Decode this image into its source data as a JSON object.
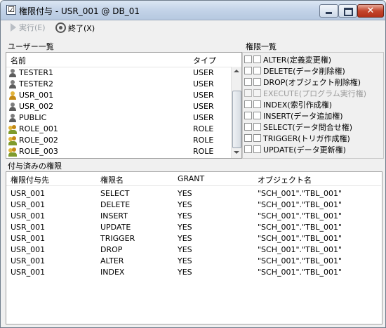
{
  "window": {
    "title": "権限付与 - USR_001 @ DB_01",
    "check": "☑",
    "close_glyph": "✕"
  },
  "toolbar": {
    "run_label": "実行(E)",
    "end_label": "終了(X)"
  },
  "users": {
    "section_label": "ユーザー一覧",
    "headers": {
      "name": "名前",
      "type": "タイプ"
    },
    "rows": [
      {
        "name": "TESTER1",
        "type": "USER",
        "icon": "user-icon"
      },
      {
        "name": "TESTER2",
        "type": "USER",
        "icon": "user-icon"
      },
      {
        "name": "USR_001",
        "type": "USER",
        "icon": "user-selected-icon"
      },
      {
        "name": "USR_002",
        "type": "USER",
        "icon": "user-icon"
      },
      {
        "name": "PUBLIC",
        "type": "USER",
        "icon": "user-icon"
      },
      {
        "name": "ROLE_001",
        "type": "ROLE",
        "icon": "role-icon"
      },
      {
        "name": "ROLE_002",
        "type": "ROLE",
        "icon": "role-icon"
      },
      {
        "name": "ROLE_003",
        "type": "ROLE",
        "icon": "role-icon"
      }
    ]
  },
  "permissions": {
    "section_label": "権限一覧",
    "items": [
      {
        "label": "ALTER(定義変更権)",
        "enabled": true
      },
      {
        "label": "DELETE(データ削除権)",
        "enabled": true
      },
      {
        "label": "DROP(オブジェクト削除権)",
        "enabled": true
      },
      {
        "label": "EXECUTE(プログラム実行権)",
        "enabled": false
      },
      {
        "label": "INDEX(索引作成権)",
        "enabled": true
      },
      {
        "label": "INSERT(データ追加権)",
        "enabled": true
      },
      {
        "label": "SELECT(データ問合せ権)",
        "enabled": true
      },
      {
        "label": "TRIGGER(トリガ作成権)",
        "enabled": true
      },
      {
        "label": "UPDATE(データ更新権)",
        "enabled": true
      }
    ]
  },
  "granted": {
    "section_label": "付与済みの権限",
    "headers": {
      "grantee": "権限付与先",
      "privilege": "権限名",
      "grant": "GRANT",
      "object": "オブジェクト名"
    },
    "rows": [
      {
        "grantee": "USR_001",
        "privilege": "SELECT",
        "grant": "YES",
        "object": "\"SCH_001\".\"TBL_001\""
      },
      {
        "grantee": "USR_001",
        "privilege": "DELETE",
        "grant": "YES",
        "object": "\"SCH_001\".\"TBL_001\""
      },
      {
        "grantee": "USR_001",
        "privilege": "INSERT",
        "grant": "YES",
        "object": "\"SCH_001\".\"TBL_001\""
      },
      {
        "grantee": "USR_001",
        "privilege": "UPDATE",
        "grant": "YES",
        "object": "\"SCH_001\".\"TBL_001\""
      },
      {
        "grantee": "USR_001",
        "privilege": "TRIGGER",
        "grant": "YES",
        "object": "\"SCH_001\".\"TBL_001\""
      },
      {
        "grantee": "USR_001",
        "privilege": "DROP",
        "grant": "YES",
        "object": "\"SCH_001\".\"TBL_001\""
      },
      {
        "grantee": "USR_001",
        "privilege": "ALTER",
        "grant": "YES",
        "object": "\"SCH_001\".\"TBL_001\""
      },
      {
        "grantee": "USR_001",
        "privilege": "INDEX",
        "grant": "YES",
        "object": "\"SCH_001\".\"TBL_001\""
      }
    ]
  }
}
